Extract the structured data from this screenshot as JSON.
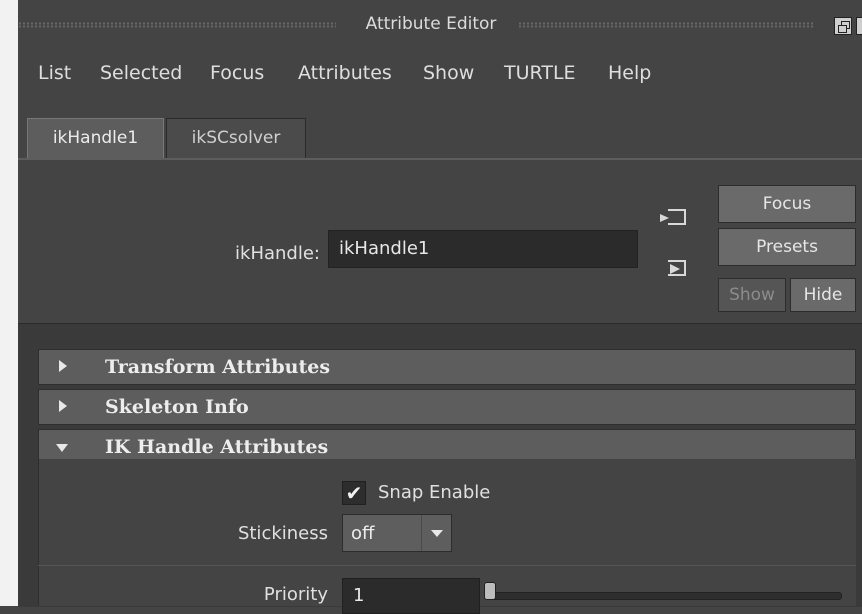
{
  "window": {
    "title": "Attribute Editor",
    "float_icon": "float-window-icon",
    "close_icon": "close-icon",
    "close_glyph": "×"
  },
  "menu": [
    "List",
    "Selected",
    "Focus",
    "Attributes",
    "Show",
    "TURTLE",
    "Help"
  ],
  "tabs": [
    {
      "label": "ikHandle1",
      "active": true
    },
    {
      "label": "ikSCsolver",
      "active": false
    }
  ],
  "node": {
    "label": "ikHandle:",
    "value": "ikHandle1"
  },
  "buttons": {
    "focus": "Focus",
    "presets": "Presets",
    "show": "Show",
    "hide": "Hide"
  },
  "sections": [
    {
      "label": "Transform Attributes",
      "expanded": false
    },
    {
      "label": "Skeleton Info",
      "expanded": false
    },
    {
      "label": "IK Handle Attributes",
      "expanded": true
    }
  ],
  "ik_attributes": {
    "snap_enable": {
      "label": "Snap Enable",
      "checked": true,
      "glyph": "✔"
    },
    "stickiness": {
      "label": "Stickiness",
      "value": "off"
    },
    "priority": {
      "label": "Priority",
      "value": "1",
      "slider_fraction": 0.0
    }
  },
  "colors": {
    "background": "#444444",
    "section_header": "#5d5d5d",
    "field": "#2b2b2b",
    "text": "#d8d8d8"
  }
}
